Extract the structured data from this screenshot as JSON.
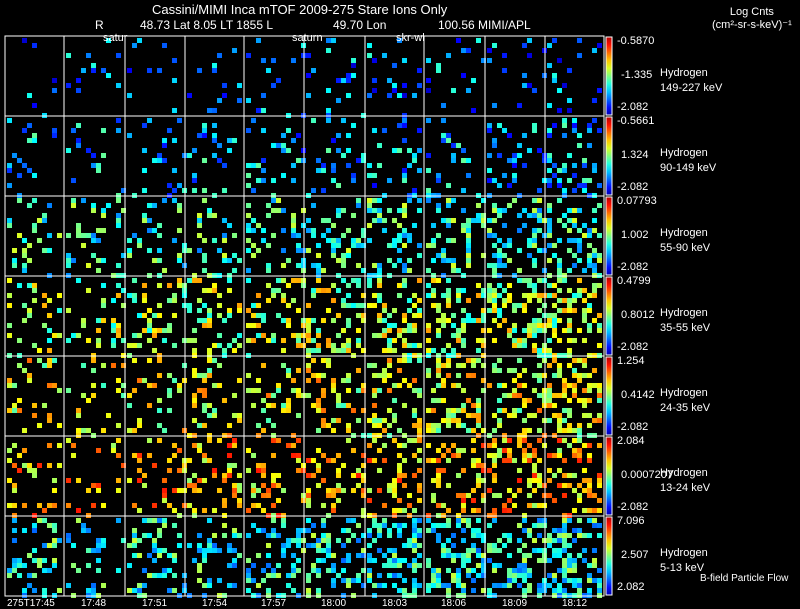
{
  "header": {
    "title": "Cassini/MIMI Inca mTOF  2009-275   Stare   Ions Only",
    "r_label": "R",
    "position": "48.73 Lat 8.05 LT 1855 L",
    "lon": "49.70 Lon",
    "lon_value": "100.56  MIMI/APL",
    "overlay_labels": [
      "satur",
      "saturn",
      "skr-wl"
    ]
  },
  "colorbar_title": {
    "line1": "Log Cnts",
    "line2": "(cm²-sr-s-keV)⁻¹"
  },
  "footer_note": "B-field Particle Flow",
  "chart_data": {
    "type": "heatmap",
    "title": "Cassini/MIMI Inca mTOF  2009-275   Stare   Ions Only",
    "colormap": "jet",
    "time_ticks": [
      "275T17:45",
      "17:48",
      "17:51",
      "17:54",
      "17:57",
      "18:00",
      "18:03",
      "18:06",
      "18:09",
      "18:12"
    ],
    "rows": [
      {
        "species": "Hydrogen",
        "energy": "149-227 keV",
        "cmax": "-0.5870",
        "cmid": "-1.335",
        "cmin": "-2.082",
        "dominant": "#1e6cff"
      },
      {
        "species": "Hydrogen",
        "energy": "90-149 keV",
        "cmax": "-0.5661",
        "cmid": "1.324",
        "cmin": "-2.082",
        "dominant": "#18a8ff"
      },
      {
        "species": "Hydrogen",
        "energy": "55-90 keV",
        "cmax": "0.07793",
        "cmid": "1.002",
        "cmin": "-2.082",
        "dominant": "#30f0e0"
      },
      {
        "species": "Hydrogen",
        "energy": "35-55 keV",
        "cmax": "0.4799",
        "cmid": "0.8012",
        "cmin": "-2.082",
        "dominant": "#80ff80"
      },
      {
        "species": "Hydrogen",
        "energy": "24-35 keV",
        "cmax": "1.254",
        "cmid": "0.4142",
        "cmin": "-2.082",
        "dominant": "#a0ff60"
      },
      {
        "species": "Hydrogen",
        "energy": "13-24 keV",
        "cmax": "2.084",
        "cmid": "0.0007207",
        "cmin": "-2.082",
        "dominant": "#d8ff40"
      },
      {
        "species": "Hydrogen",
        "energy": "5-13 keV",
        "cmax": "7.096",
        "cmid": "2.507",
        "cmin": "2.082",
        "dominant": "#30ffe8"
      }
    ]
  }
}
